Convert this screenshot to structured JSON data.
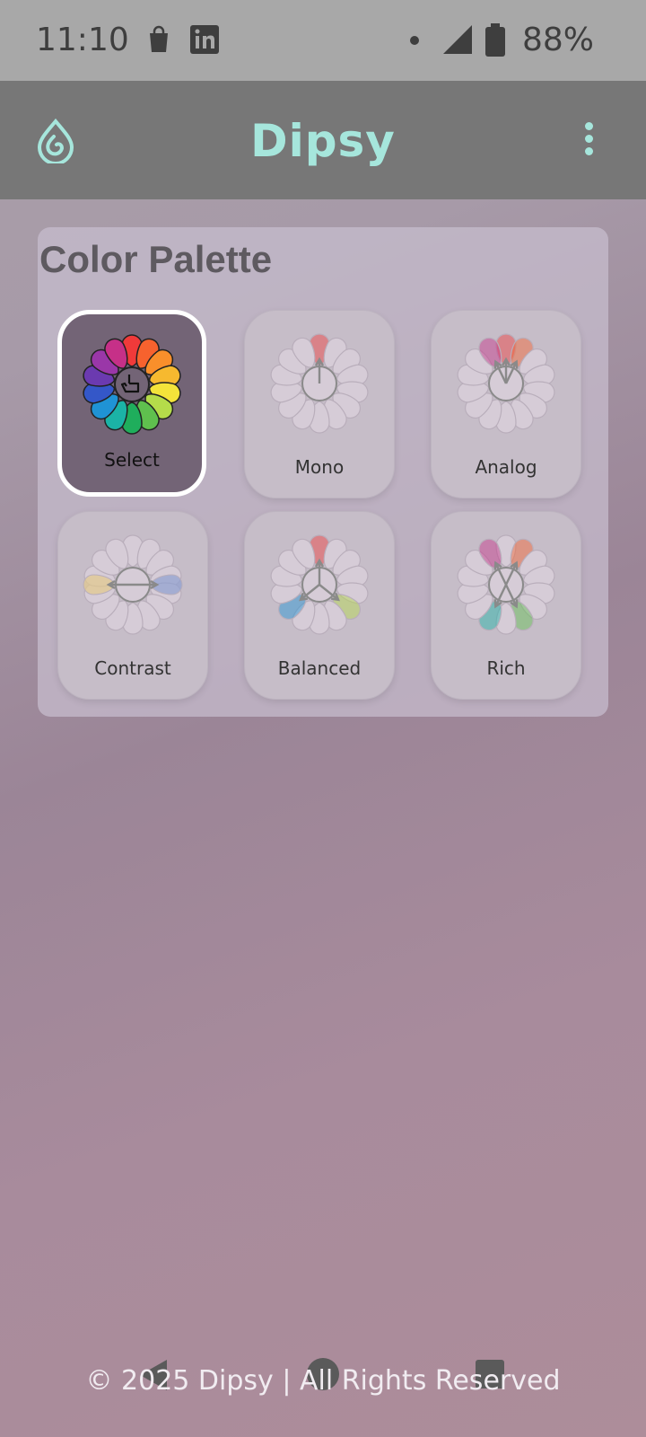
{
  "status_bar": {
    "time": "11:10",
    "battery": "88%",
    "icons": [
      "shopping-bag-icon",
      "linkedin-icon",
      "dot-icon",
      "signal-icon",
      "battery-icon"
    ]
  },
  "app_bar": {
    "title": "Dipsy",
    "accent_color": "#a6e6dc",
    "icons": [
      "water-drop-logo-icon",
      "more-vert-icon"
    ]
  },
  "palette": {
    "heading": "Color Palette",
    "options": [
      {
        "label": "Select",
        "selected": true
      },
      {
        "label": "Mono",
        "selected": false
      },
      {
        "label": "Analog",
        "selected": false
      },
      {
        "label": "Contrast",
        "selected": false
      },
      {
        "label": "Balanced",
        "selected": false
      },
      {
        "label": "Rich",
        "selected": false
      }
    ],
    "wheel_colors": [
      "#f03a3a",
      "#f7622e",
      "#f98f2b",
      "#f6b92f",
      "#f3e33a",
      "#b5dc4a",
      "#5fc04e",
      "#1fae5c",
      "#1bb3a6",
      "#1f93d5",
      "#3457c8",
      "#6b3ab0",
      "#9a37a8",
      "#c63088"
    ]
  },
  "footer": {
    "text": "© 2025 Dipsy | All Rights Reserved"
  },
  "nav_bar": {
    "icons": [
      "back-triangle-icon",
      "home-circle-icon",
      "recents-square-icon"
    ]
  }
}
